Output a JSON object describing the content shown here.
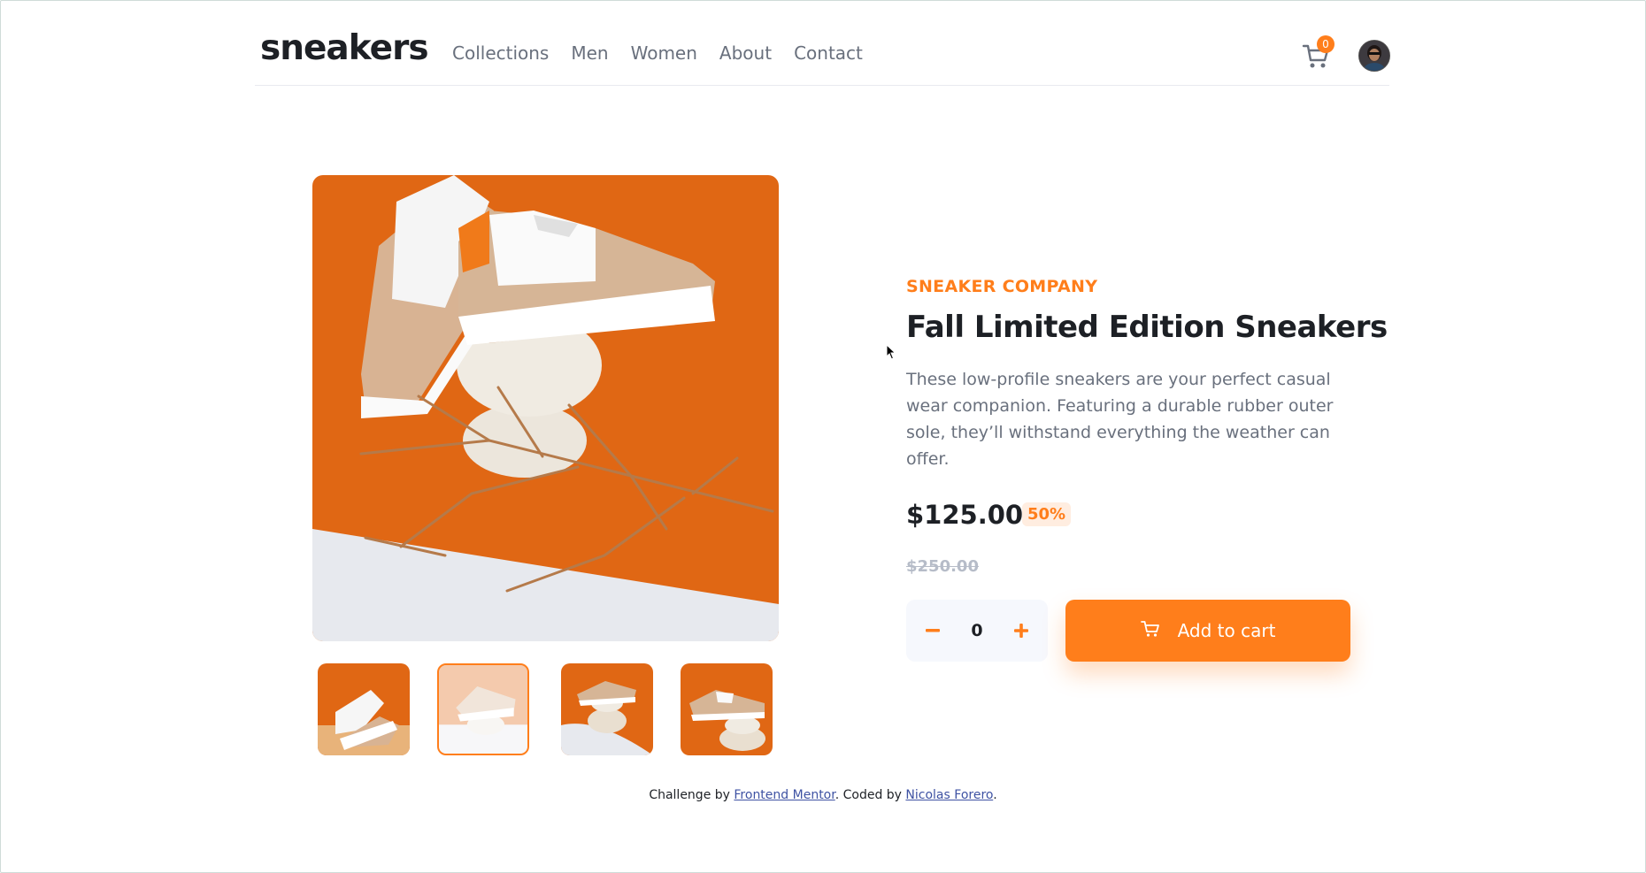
{
  "header": {
    "logo": "sneakers",
    "nav": [
      "Collections",
      "Men",
      "Women",
      "About",
      "Contact"
    ],
    "cart_count": "0",
    "cart_icon": "cart-icon",
    "avatar": "user-avatar"
  },
  "gallery": {
    "main_image": "sneaker-product-image-1",
    "thumbnails": [
      "sneaker-thumb-1",
      "sneaker-thumb-2",
      "sneaker-thumb-3",
      "sneaker-thumb-4"
    ],
    "active_thumbnail": 2
  },
  "product": {
    "company": "SNEAKER COMPANY",
    "title": "Fall Limited Edition Sneakers",
    "description": "These low-profile sneakers are your perfect casual wear companion. Featuring a durable rubber outer sole, they’ll withstand everything the weather can offer.",
    "price": "$125.00",
    "discount": "50%",
    "original_price": "$250.00",
    "quantity": "0",
    "minus_icon": "minus-icon",
    "plus_icon": "plus-icon",
    "add_to_cart": "Add to cart"
  },
  "footer": {
    "prefix": "Challenge by ",
    "link1": "Frontend Mentor",
    "middle": ". Coded by ",
    "link2": "Nicolas Forero",
    "suffix": "."
  },
  "colors": {
    "accent": "#ff7e1b",
    "accent_pale": "#ffede0",
    "dark_text": "#1d2025",
    "grey_text": "#69707d",
    "light_bg": "#f6f8fd"
  }
}
